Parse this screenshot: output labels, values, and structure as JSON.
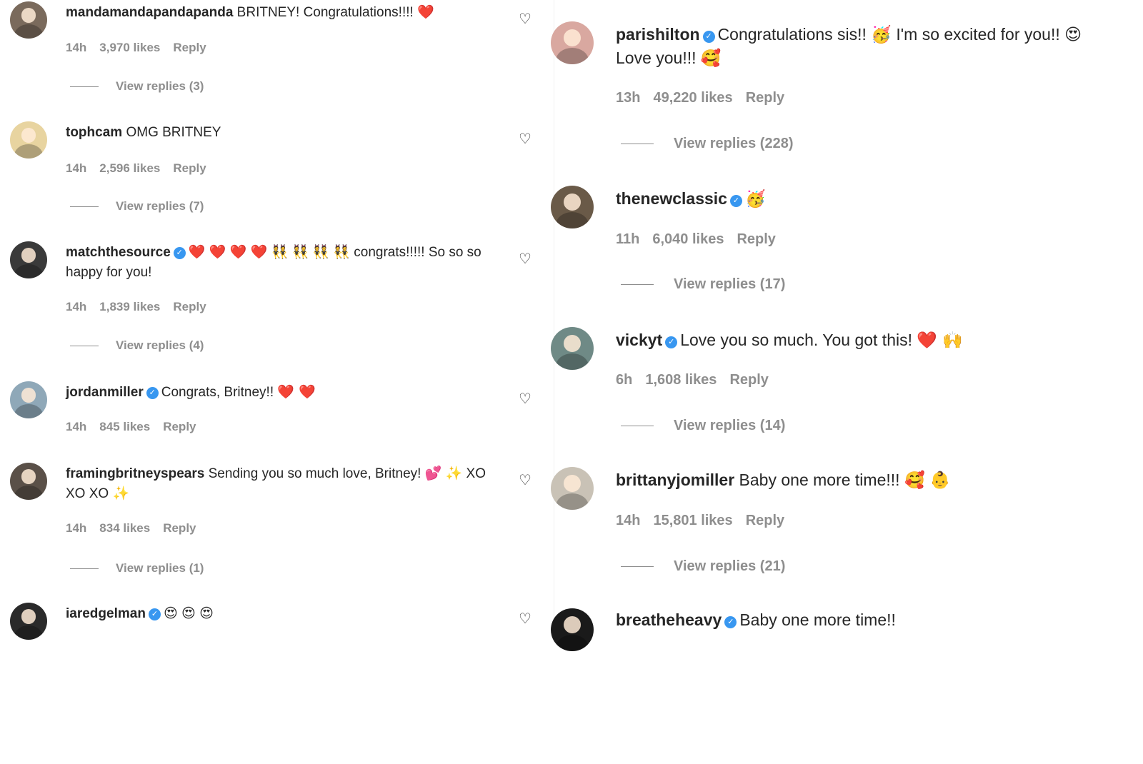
{
  "left_comments": [
    {
      "username": "mandamandapandapanda",
      "verified": false,
      "text": "BRITNEY! Congratulations!!!!",
      "emoji": "❤️",
      "time": "14h",
      "likes": "3,970 likes",
      "reply": "Reply",
      "view_replies": "View replies (3)",
      "avatar_color": "#7a6a5c"
    },
    {
      "username": "tophcam",
      "verified": false,
      "text": "OMG BRITNEY",
      "emoji": "",
      "time": "14h",
      "likes": "2,596 likes",
      "reply": "Reply",
      "view_replies": "View replies (7)",
      "avatar_color": "#e8d4a0"
    },
    {
      "username": "matchthesource",
      "verified": true,
      "text": "❤️ ❤️ ❤️ ❤️ 👯 👯 👯 👯 congrats!!!!! So so so happy for you!",
      "emoji": "",
      "time": "14h",
      "likes": "1,839 likes",
      "reply": "Reply",
      "view_replies": "View replies (4)",
      "avatar_color": "#3a3a3a"
    },
    {
      "username": "jordanmiller",
      "verified": true,
      "text": "Congrats, Britney!!",
      "emoji": "❤️ ❤️",
      "time": "14h",
      "likes": "845 likes",
      "reply": "Reply",
      "view_replies": "",
      "avatar_color": "#8fa8b8"
    },
    {
      "username": "framingbritneyspears",
      "verified": false,
      "text": "Sending you so much love, Britney! 💕 ✨ XO XO XO ✨",
      "emoji": "",
      "time": "14h",
      "likes": "834 likes",
      "reply": "Reply",
      "view_replies": "View replies (1)",
      "avatar_color": "#5a5048"
    },
    {
      "username": "iaredgelman",
      "verified": true,
      "text": "😍 😍 😍",
      "emoji": "",
      "time": "",
      "likes": "",
      "reply": "",
      "view_replies": "",
      "avatar_color": "#2a2a2a"
    }
  ],
  "right_comments": [
    {
      "username": "parishilton",
      "verified": true,
      "text": "Congratulations sis!! 🥳 I'm so excited for you!! 😍 Love you!!! 🥰",
      "emoji": "",
      "time": "13h",
      "likes": "49,220 likes",
      "reply": "Reply",
      "view_replies": "View replies (228)",
      "avatar_color": "#d9a8a0"
    },
    {
      "username": "thenewclassic",
      "verified": true,
      "text": "🥳",
      "emoji": "",
      "time": "11h",
      "likes": "6,040 likes",
      "reply": "Reply",
      "view_replies": "View replies (17)",
      "avatar_color": "#6a5a48"
    },
    {
      "username": "vickyt",
      "verified": true,
      "text": "Love you so much. You got this!",
      "emoji": "❤️ 🙌",
      "time": "6h",
      "likes": "1,608 likes",
      "reply": "Reply",
      "view_replies": "View replies (14)",
      "avatar_color": "#6f8a86"
    },
    {
      "username": "brittanyjomiller",
      "verified": false,
      "text": "Baby one more time!!!",
      "emoji": "🥰 👶",
      "time": "14h",
      "likes": "15,801 likes",
      "reply": "Reply",
      "view_replies": "View replies (21)",
      "avatar_color": "#c9c2b6"
    },
    {
      "username": "breatheheavy",
      "verified": true,
      "text": "Baby one more time!!",
      "emoji": "",
      "time": "",
      "likes": "",
      "reply": "",
      "view_replies": "",
      "avatar_color": "#1a1a1a"
    }
  ],
  "icons": {
    "like": "heart-outline-icon",
    "verified": "verified-badge-icon"
  },
  "colors": {
    "verified": "#3897f0",
    "muted": "#8e8e8e",
    "heart": "#ed4956"
  }
}
